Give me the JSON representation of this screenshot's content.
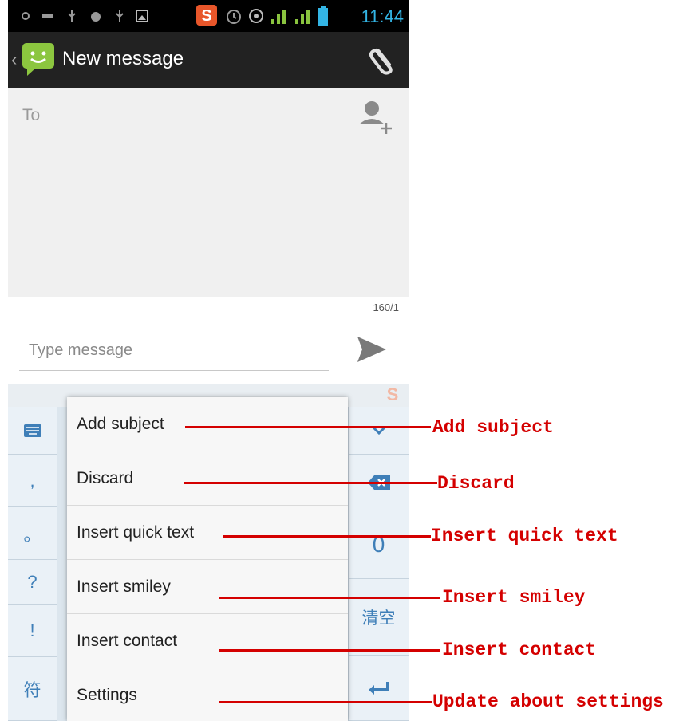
{
  "status_bar": {
    "time": "11:44"
  },
  "action_bar": {
    "title": "New message"
  },
  "compose": {
    "to_placeholder": "To",
    "char_counter": "160/1",
    "message_placeholder": "Type message"
  },
  "keyboard": {
    "left_keys": [
      ",",
      "。",
      "?",
      "!",
      "符"
    ],
    "right_keys": [
      "0",
      "清空"
    ]
  },
  "menu": {
    "items": [
      {
        "label": "Add subject"
      },
      {
        "label": "Discard"
      },
      {
        "label": "Insert quick text"
      },
      {
        "label": "Insert smiley"
      },
      {
        "label": "Insert contact"
      },
      {
        "label": "Settings"
      }
    ]
  },
  "annotations": [
    "Add subject",
    "Discard",
    "Insert quick text",
    "Insert smiley",
    "Insert contact",
    "Update about settings"
  ],
  "colors": {
    "accent": "#33b5e5",
    "annotation": "#d40000",
    "key_text": "#3f7fb8"
  }
}
